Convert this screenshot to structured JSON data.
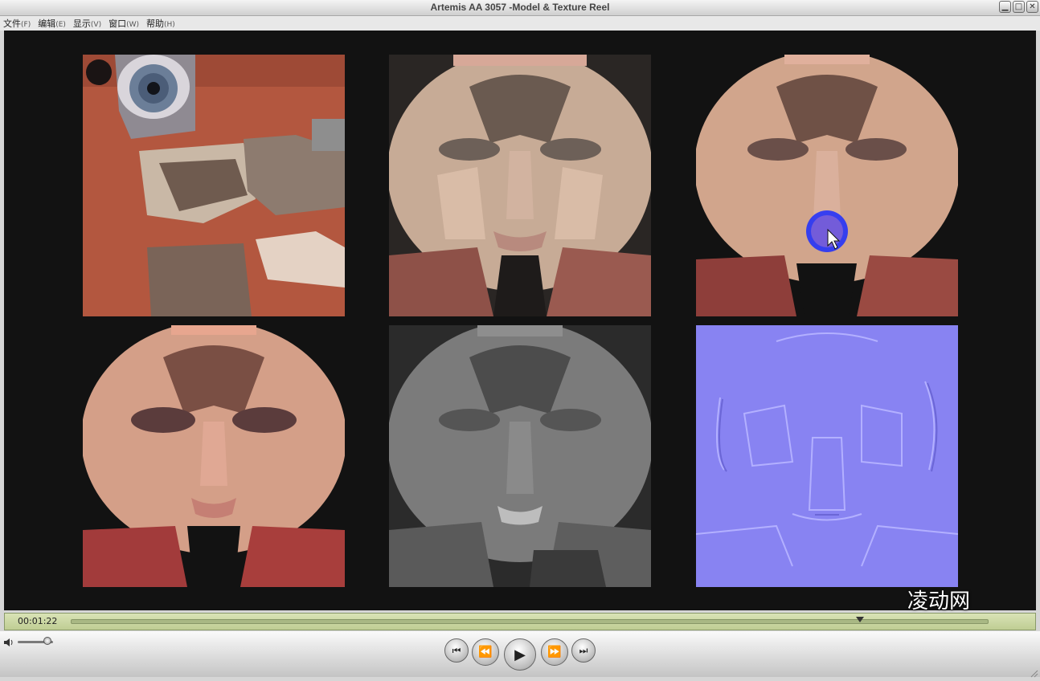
{
  "window": {
    "title": "Artemis AA 3057 -Model & Texture Reel",
    "minimize_glyph": "▁",
    "maximize_glyph": "□",
    "close_glyph": "✕"
  },
  "menu": [
    {
      "label": "文件",
      "key": "(F)"
    },
    {
      "label": "编辑",
      "key": "(E)"
    },
    {
      "label": "显示",
      "key": "(V)"
    },
    {
      "label": "窗口",
      "key": "(W)"
    },
    {
      "label": "帮助",
      "key": "(H)"
    }
  ],
  "video": {
    "tiles": [
      {
        "name": "eye-skin-texture-tile",
        "kind": "eye"
      },
      {
        "name": "face-color-texture-tile",
        "kind": "face-light"
      },
      {
        "name": "face-paint-texture-tile",
        "kind": "face-paint"
      },
      {
        "name": "face-makeup-texture-tile",
        "kind": "face-makeup"
      },
      {
        "name": "face-grayscale-texture-tile",
        "kind": "face-gray"
      },
      {
        "name": "face-normal-map-tile",
        "kind": "normal"
      }
    ],
    "watermark": "凌动网"
  },
  "player": {
    "timecode": "00:01:22",
    "progress": 0.86,
    "volume": 0.85,
    "buttons": {
      "prev": "⏮",
      "rewind": "⏪",
      "play": "▶",
      "forward": "⏩",
      "next": "⏭"
    }
  },
  "colors": {
    "video_bg": "#121212",
    "timeline_bg": "#c7d39e",
    "brush_blue": "#1a2cff"
  }
}
